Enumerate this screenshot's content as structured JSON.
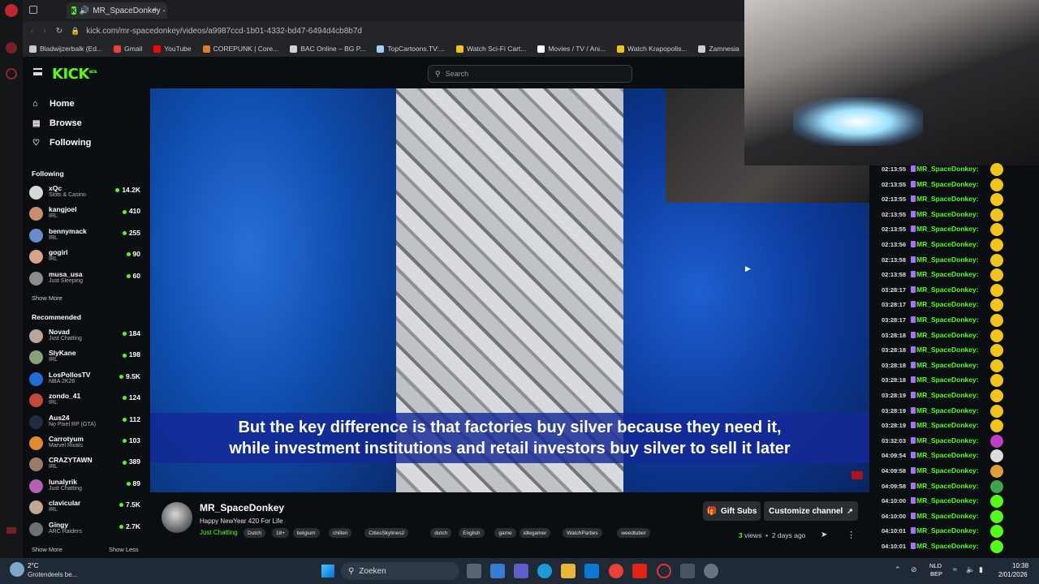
{
  "browser": {
    "tab_title": "MR_SpaceDonkey - W...",
    "url": "kick.com/mr-spacedonkey/videos/a9987ccd-1b01-4332-bd47-6494d4cb8b7d",
    "bookmarks": [
      {
        "label": "Bladwijzerbalk (Ed...",
        "color": "#c9c9c9"
      },
      {
        "label": "Gmail",
        "color": "#ea4335"
      },
      {
        "label": "YouTube",
        "color": "#ff0000"
      },
      {
        "label": "COREPUNK | Core...",
        "color": "#e07a2e"
      },
      {
        "label": "BAC Online – BG P...",
        "color": "#d0d0d0"
      },
      {
        "label": "TopCartoons.TV:...",
        "color": "#9bd0ff"
      },
      {
        "label": "Watch Sci-Fi Cart...",
        "color": "#f0c419"
      },
      {
        "label": "Movies / TV / Ani...",
        "color": "#ffffff"
      },
      {
        "label": "Watch Krapopolis...",
        "color": "#f0c419"
      },
      {
        "label": "Zamnesia",
        "color": "#cfcfcf"
      }
    ]
  },
  "kick": {
    "logo": "KICK",
    "logo_sup": "BETA",
    "search_placeholder": "Search"
  },
  "sidebar": {
    "nav": [
      {
        "label": "Home",
        "icon": "home-icon"
      },
      {
        "label": "Browse",
        "icon": "browse-icon"
      },
      {
        "label": "Following",
        "icon": "heart-icon"
      }
    ],
    "following_title": "Following",
    "following": [
      {
        "name": "xQc",
        "category": "Slots & Casino",
        "viewers": "14.2K",
        "color": "#d7d7d7"
      },
      {
        "name": "kangjoel",
        "category": "IRL",
        "viewers": "410",
        "color": "#c98f6c"
      },
      {
        "name": "bennymack",
        "category": "IRL",
        "viewers": "255",
        "color": "#6a8cc9"
      },
      {
        "name": "gogirl",
        "category": "IRL",
        "viewers": "90",
        "color": "#d7a48a"
      },
      {
        "name": "musa_usa",
        "category": "Just Sleeping",
        "viewers": "60",
        "color": "#8d8d8d"
      }
    ],
    "show_more": "Show More",
    "recommended_title": "Recommended",
    "recommended": [
      {
        "name": "Novad",
        "category": "Just Chatting",
        "viewers": "184",
        "color": "#b9a59a"
      },
      {
        "name": "SlyKane",
        "category": "IRL",
        "viewers": "198",
        "color": "#8aa07a"
      },
      {
        "name": "LosPollosTV",
        "category": "NBA 2K26",
        "viewers": "9.5K",
        "color": "#1e6fd6"
      },
      {
        "name": "zondo_41",
        "category": "IRL",
        "viewers": "124",
        "color": "#c24a3a"
      },
      {
        "name": "Aus24",
        "category": "No Pixel RP (GTA)",
        "viewers": "112",
        "color": "#222a44"
      },
      {
        "name": "Carrotyum",
        "category": "Marvel Rivals",
        "viewers": "103",
        "color": "#e08b2e"
      },
      {
        "name": "CRAZYTAWN",
        "category": "IRL",
        "viewers": "389",
        "color": "#9a7a6a"
      },
      {
        "name": "lunalyrik",
        "category": "Just Chatting",
        "viewers": "89",
        "color": "#b55fb0"
      },
      {
        "name": "clavicular",
        "category": "IRL",
        "viewers": "7.5K",
        "color": "#c0a88e"
      },
      {
        "name": "Gingy",
        "category": "ARC Raiders",
        "viewers": "2.7K",
        "color": "#6f6f6f"
      }
    ],
    "show_more_2": "Show More",
    "show_less": "Show Less"
  },
  "video": {
    "subtitle_line1": "But the key difference is that factories buy silver because they need it,",
    "subtitle_line2": "while investment institutions and retail investors buy silver to sell it later"
  },
  "chat": {
    "messages": [
      {
        "time": "02:13:55",
        "user": "MR_SpaceDonkey:",
        "emote": "#f0c419"
      },
      {
        "time": "02:13:55",
        "user": "MR_SpaceDonkey:",
        "emote": "#f0c419"
      },
      {
        "time": "02:13:55",
        "user": "MR_SpaceDonkey:",
        "emote": "#f0c419"
      },
      {
        "time": "02:13:55",
        "user": "MR_SpaceDonkey:",
        "emote": "#f0c419"
      },
      {
        "time": "02:13:55",
        "user": "MR_SpaceDonkey:",
        "emote": "#f0c419"
      },
      {
        "time": "02:13:56",
        "user": "MR_SpaceDonkey:",
        "emote": "#f0c419"
      },
      {
        "time": "02:13:58",
        "user": "MR_SpaceDonkey:",
        "emote": "#f0c419"
      },
      {
        "time": "02:13:58",
        "user": "MR_SpaceDonkey:",
        "emote": "#f0c419"
      },
      {
        "time": "03:28:17",
        "user": "MR_SpaceDonkey:",
        "emote": "#f0c419"
      },
      {
        "time": "03:28:17",
        "user": "MR_SpaceDonkey:",
        "emote": "#f0c419"
      },
      {
        "time": "03:28:17",
        "user": "MR_SpaceDonkey:",
        "emote": "#f0c419"
      },
      {
        "time": "03:28:18",
        "user": "MR_SpaceDonkey:",
        "emote": "#f0c419"
      },
      {
        "time": "03:28:18",
        "user": "MR_SpaceDonkey:",
        "emote": "#f0c419"
      },
      {
        "time": "03:28:18",
        "user": "MR_SpaceDonkey:",
        "emote": "#f0c419"
      },
      {
        "time": "03:28:18",
        "user": "MR_SpaceDonkey:",
        "emote": "#f0c419"
      },
      {
        "time": "03:28:19",
        "user": "MR_SpaceDonkey:",
        "emote": "#f0c419"
      },
      {
        "time": "03:28:19",
        "user": "MR_SpaceDonkey:",
        "emote": "#f0c419"
      },
      {
        "time": "03:28:19",
        "user": "MR_SpaceDonkey:",
        "emote": "#f0c419"
      },
      {
        "time": "03:32:03",
        "user": "MR_SpaceDonkey:",
        "emote": "#c03cc8"
      },
      {
        "time": "04:09:54",
        "user": "MR_SpaceDonkey:",
        "emote": "#dcdcdc"
      },
      {
        "time": "04:09:58",
        "user": "MR_SpaceDonkey:",
        "emote": "#e0a030"
      },
      {
        "time": "04:09:58",
        "user": "MR_SpaceDonkey:",
        "emote": "#3fa34d"
      },
      {
        "time": "04:10:00",
        "user": "MR_SpaceDonkey:",
        "emote": "#53fc18"
      },
      {
        "time": "04:10:00",
        "user": "MR_SpaceDonkey:",
        "emote": "#53fc18"
      },
      {
        "time": "04:10:01",
        "user": "MR_SpaceDonkey:",
        "emote": "#53fc18"
      },
      {
        "time": "04:10:01",
        "user": "MR_SpaceDonkey:",
        "emote": "#53fc18"
      }
    ]
  },
  "stream": {
    "name": "MR_SpaceDonkey",
    "title": "Happy NewYear 420 For Life",
    "category": "Just Chatting",
    "tags": [
      "Dutch",
      "18+",
      "belgium",
      "chillen",
      "CitiesSkylines2",
      "dutch",
      "English",
      "game",
      "idlegamer",
      "WatchParties",
      "weedtuber"
    ],
    "gift_subs": "Gift Subs",
    "customize": "Customize channel",
    "views_count": "3",
    "views_label": "views",
    "ago": "2 days ago"
  },
  "taskbar": {
    "weather_temp": "2°C",
    "weather_desc": "Grotendeels be...",
    "search": "Zoeken",
    "lang1": "NLD",
    "lang2": "BEP",
    "time": "10:38",
    "date": "2/01/2026"
  }
}
